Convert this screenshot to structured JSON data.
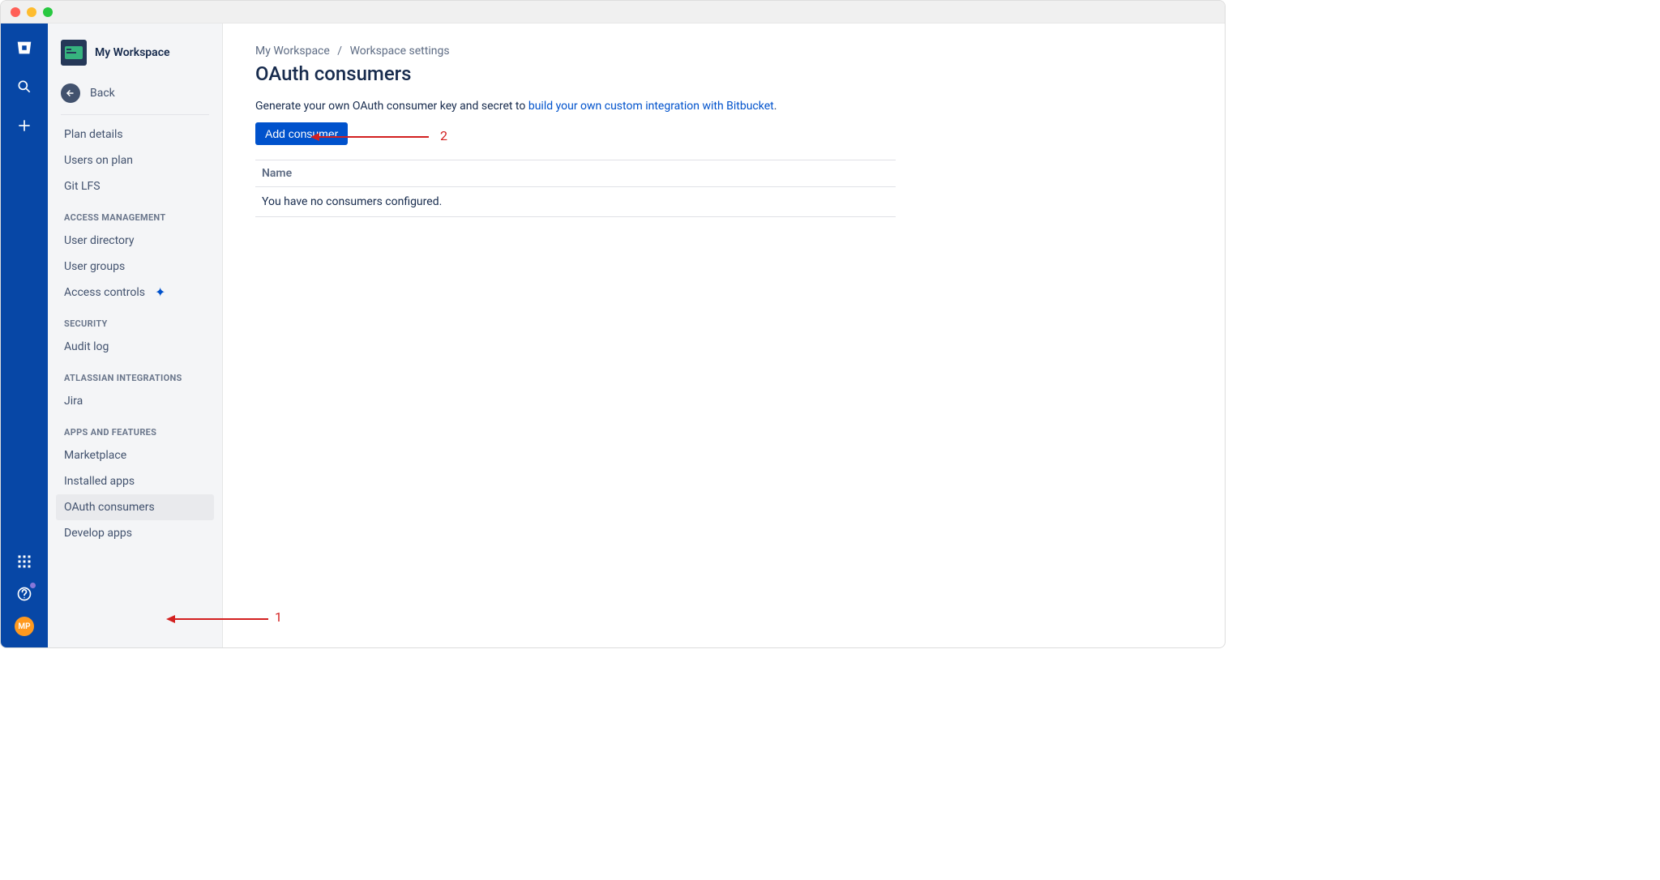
{
  "workspace": {
    "name": "My Workspace"
  },
  "sidebar": {
    "back_label": "Back",
    "items_top": [
      "Plan details",
      "Users on plan",
      "Git LFS"
    ],
    "headings": {
      "access": "ACCESS MANAGEMENT",
      "security": "SECURITY",
      "integrations": "ATLASSIAN INTEGRATIONS",
      "apps": "APPS AND FEATURES"
    },
    "access_items": [
      "User directory",
      "User groups",
      "Access controls"
    ],
    "security_items": [
      "Audit log"
    ],
    "integration_items": [
      "Jira"
    ],
    "apps_items": [
      "Marketplace",
      "Installed apps",
      "OAuth consumers",
      "Develop apps"
    ]
  },
  "breadcrumb": {
    "root": "My Workspace",
    "page": "Workspace settings"
  },
  "main": {
    "title": "OAuth consumers",
    "desc_prefix": "Generate your own OAuth consumer key and secret to ",
    "desc_link": "build your own custom integration with Bitbucket",
    "desc_suffix": ".",
    "add_button": "Add consumer",
    "table_header": "Name",
    "empty_message": "You have no consumers configured."
  },
  "rail": {
    "avatar_initials": "MP"
  },
  "annotations": {
    "a1": "1",
    "a2": "2"
  }
}
